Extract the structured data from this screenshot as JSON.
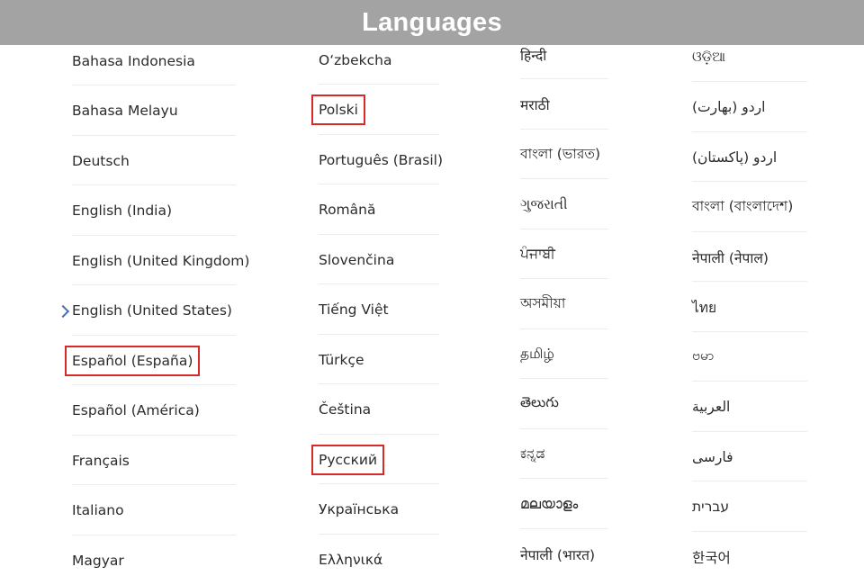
{
  "header": {
    "title": "Languages"
  },
  "selection_color": "#d62a2a",
  "current_indicator_icon": "chevron-right-icon",
  "columns": [
    {
      "items": [
        {
          "label": "Bahasa Indonesia"
        },
        {
          "label": "Bahasa Melayu"
        },
        {
          "label": "Deutsch"
        },
        {
          "label": "English (India)"
        },
        {
          "label": "English (United Kingdom)"
        },
        {
          "label": "English (United States)",
          "current": true
        },
        {
          "label": "Español (España)",
          "highlighted": true
        },
        {
          "label": "Español (América)"
        },
        {
          "label": "Français"
        },
        {
          "label": "Italiano"
        },
        {
          "label": "Magyar"
        }
      ]
    },
    {
      "items": [
        {
          "label": "Oʻzbekcha"
        },
        {
          "label": "Polski",
          "highlighted": true
        },
        {
          "label": "Português (Brasil)"
        },
        {
          "label": "Română"
        },
        {
          "label": "Slovenčina"
        },
        {
          "label": "Tiếng Việt"
        },
        {
          "label": "Türkçe"
        },
        {
          "label": "Čeština"
        },
        {
          "label": "Русский",
          "highlighted": true
        },
        {
          "label": "Українська"
        },
        {
          "label": "Ελληνικά"
        }
      ]
    },
    {
      "items": [
        {
          "label": "हिन्दी"
        },
        {
          "label": "मराठी"
        },
        {
          "label": "বাংলা (ভারত)"
        },
        {
          "label": "ગુજરાતી"
        },
        {
          "label": "ਪੰਜਾਬੀ"
        },
        {
          "label": "অসমীয়া"
        },
        {
          "label": "தமிழ்"
        },
        {
          "label": "తెలుగు"
        },
        {
          "label": "ಕನ್ನಡ"
        },
        {
          "label": "മലയാളം"
        },
        {
          "label": "नेपाली (भारत)"
        }
      ]
    },
    {
      "items": [
        {
          "label": "ଓଡ଼ିଆ"
        },
        {
          "label": "اردو (بھارت)"
        },
        {
          "label": "اردو (پاکستان)"
        },
        {
          "label": "বাংলা (বাংলাদেশ)"
        },
        {
          "label": "नेपाली (नेपाल)"
        },
        {
          "label": "ไทย"
        },
        {
          "label": "ဗမာ"
        },
        {
          "label": "العربية"
        },
        {
          "label": "فارسی"
        },
        {
          "label": "עברית"
        },
        {
          "label": "한국어"
        }
      ]
    }
  ]
}
